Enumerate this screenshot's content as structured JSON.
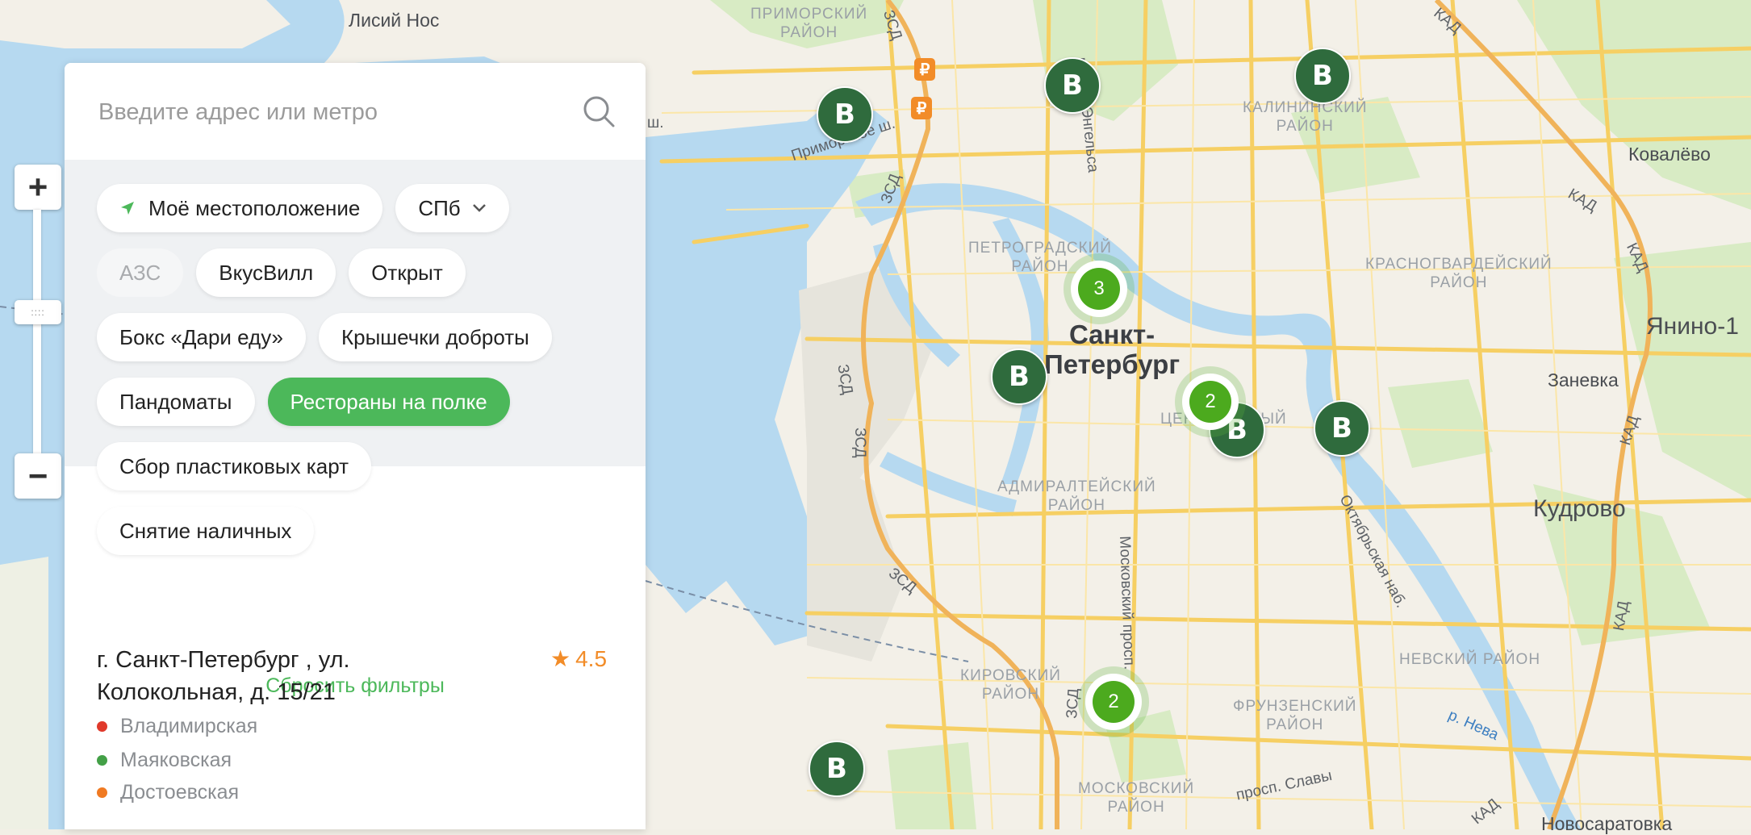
{
  "search": {
    "placeholder": "Введите адрес или метро"
  },
  "filters": {
    "location_label": "Моё местоположение",
    "city_select": "СПб",
    "chips": [
      {
        "label": "АЗС",
        "state": "disabled"
      },
      {
        "label": "ВкусВилл",
        "state": "normal"
      },
      {
        "label": "Открыт",
        "state": "normal"
      },
      {
        "label": "Бокс «Дари еду»",
        "state": "normal"
      },
      {
        "label": "Крышечки доброты",
        "state": "normal"
      },
      {
        "label": "Пандоматы",
        "state": "normal"
      },
      {
        "label": "Рестораны на полке",
        "state": "active"
      },
      {
        "label": "Сбор пластиковых карт",
        "state": "normal"
      },
      {
        "label": "Снятие наличных",
        "state": "normal"
      }
    ],
    "reset_label": "Сбросить фильтры"
  },
  "result": {
    "address": "г. Санкт-Петербург , ул. Колокольная, д. 15/21",
    "rating_star": "★",
    "rating": "4.5",
    "metro": [
      {
        "name": "Владимирская",
        "color": "#e0392b"
      },
      {
        "name": "Маяковская",
        "color": "#43a047"
      },
      {
        "name": "Достоевская",
        "color": "#f07a22"
      }
    ]
  },
  "zoom": {
    "plus": "+",
    "minus": "−",
    "thumb": "::::"
  },
  "map": {
    "marker_letter": "В",
    "clusters": [
      "3",
      "2",
      "2"
    ],
    "rub_symbol": "₽",
    "labels": {
      "lisiy_nos": "Лисий Нос",
      "primorsky": "ПРИМОРСКИЙ\nРАЙОН",
      "kalininsky": "КАЛИНИНСКИЙ\nРАЙОН",
      "petrogradsky": "ПЕТРОГРАДСКИЙ\nРАЙОН",
      "krasnogvardeysky": "КРАСНОГВАРДЕЙСКИЙ\nРАЙОН",
      "admiralteysky": "АДМИРАЛТЕЙСКИЙ\nРАЙОН",
      "kirovsky": "КИРОВСКИЙ\nРАЙОН",
      "frunzensky": "ФРУНЗЕНСКИЙ\nРАЙОН",
      "nevsky": "НЕВСКИЙ РАЙОН",
      "moskovsky": "МОСКОВСКИЙ\nРАЙОН",
      "tsentralny": "ЦЕНТРАЛЬНЫЙ",
      "city": "Санкт-\nПетербург",
      "kovalevo": "Ковалёво",
      "yanino": "Янино-1",
      "zanevka": "Заневка",
      "kudrovo": "Кудрово",
      "novosaratovka": "Новосаратовка",
      "pr_engelsa": "просп. Энгельса",
      "primorskoe_sh": "Приморское ш.",
      "moskovsky_pr": "Московский просп.",
      "pr_slavy": "просп. Славы",
      "oktyabrskaya": "Октябрьская наб.",
      "r_neva": "р. Нева",
      "zsd": "ЗСД",
      "kad": "КАД",
      "sh": "ш."
    }
  }
}
